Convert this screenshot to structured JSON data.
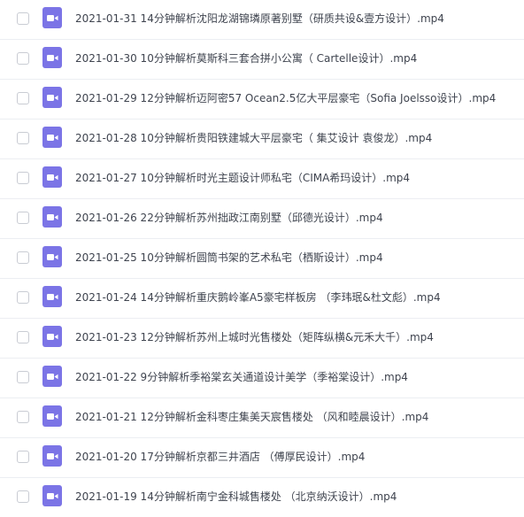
{
  "colors": {
    "icon_bg": "#7b74e6",
    "icon_glyph": "#ffffff",
    "text": "#3f444f",
    "divider": "#eceef2",
    "checkbox_border": "#c9ccd3"
  },
  "file_icon": "video-file-icon",
  "files": [
    {
      "name": "2021-01-31 14分钟解析沈阳龙湖锦璘原著别墅（研质共设&壹方设计）.mp4"
    },
    {
      "name": "2021-01-30 10分钟解析莫斯科三套合拼小公寓（ Cartelle设计）.mp4"
    },
    {
      "name": "2021-01-29 12分钟解析迈阿密57 Ocean2.5亿大平层豪宅（Sofia Joelsso设计）.mp4"
    },
    {
      "name": "2021-01-28 10分钟解析贵阳铁建城大平层豪宅（ 集艾设计 袁俊龙）.mp4"
    },
    {
      "name": "2021-01-27 10分钟解析时光主题设计师私宅（CIMA希玛设计）.mp4"
    },
    {
      "name": "2021-01-26 22分钟解析苏州拙政江南别墅（邱德光设计）.mp4"
    },
    {
      "name": "2021-01-25 10分钟解析圆筒书架的艺术私宅（栖斯设计）.mp4"
    },
    {
      "name": "2021-01-24 14分钟解析重庆鹅岭峯A5豪宅样板房 （李玮珉&杜文彪）.mp4"
    },
    {
      "name": "2021-01-23 12分钟解析苏州上城时光售楼处（矩阵纵横&元禾大千）.mp4"
    },
    {
      "name": "2021-01-22 9分钟解析季裕棠玄关通道设计美学（季裕棠设计）.mp4"
    },
    {
      "name": "2021-01-21 12分钟解析金科枣庄集美天宸售楼处 （风和睦晨设计）.mp4"
    },
    {
      "name": "2021-01-20 17分钟解析京都三井酒店 （傅厚民设计）.mp4"
    },
    {
      "name": "2021-01-19 14分钟解析南宁金科城售楼处 （北京纳沃设计）.mp4"
    }
  ]
}
